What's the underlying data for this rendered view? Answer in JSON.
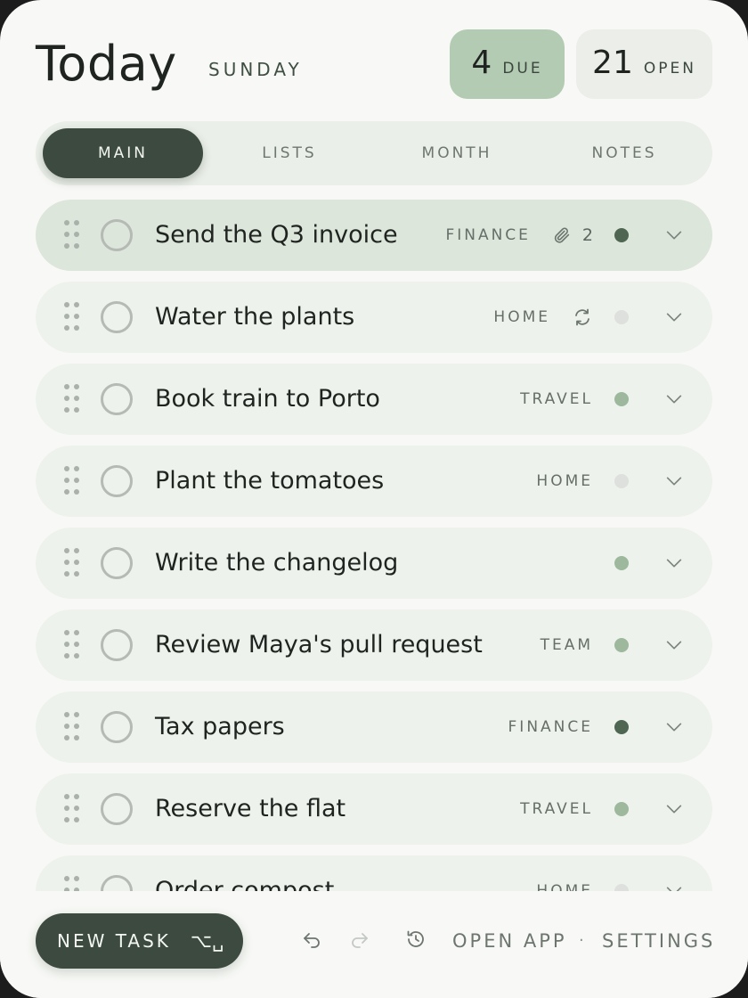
{
  "header": {
    "title": "Today",
    "weekday": "SUNDAY",
    "due": {
      "count": "4",
      "label": "DUE"
    },
    "open": {
      "count": "21",
      "label": "OPEN"
    }
  },
  "tabs": [
    {
      "label": "MAIN",
      "active": true
    },
    {
      "label": "LISTS",
      "active": false
    },
    {
      "label": "MONTH",
      "active": false
    },
    {
      "label": "NOTES",
      "active": false
    }
  ],
  "colors": {
    "accent_dark": "#3c4a3f",
    "accent_light": "#b4cbb3",
    "dot_dark": "#4f6652",
    "dot_medium": "#9db89c",
    "dot_light": "#dde0dc"
  },
  "tasks": [
    {
      "title": "Send the Q3 invoice",
      "tag": "FINANCE",
      "attachments": "2",
      "icon": "paperclip-icon",
      "priority": "dark",
      "highlighted": true
    },
    {
      "title": "Water the plants",
      "tag": "HOME",
      "icon": "repeat-icon",
      "priority": "light"
    },
    {
      "title": "Book train to Porto",
      "tag": "TRAVEL",
      "priority": "medium"
    },
    {
      "title": "Plant the tomatoes",
      "tag": "HOME",
      "priority": "light"
    },
    {
      "title": "Write the changelog",
      "tag": "",
      "priority": "medium"
    },
    {
      "title": "Review Maya's pull request",
      "tag": "TEAM",
      "priority": "medium"
    },
    {
      "title": "Tax papers",
      "tag": "FINANCE",
      "priority": "dark"
    },
    {
      "title": "Reserve the flat",
      "tag": "TRAVEL",
      "priority": "medium"
    },
    {
      "title": "Order compost",
      "tag": "HOME",
      "priority": "light"
    }
  ],
  "footer": {
    "new_task": "NEW TASK",
    "new_task_shortcut": "⌥␣",
    "undo_icon": "undo-icon",
    "redo_icon": "redo-icon",
    "history_icon": "history-icon",
    "open_app": "OPEN APP",
    "separator": "·",
    "settings": "SETTINGS"
  }
}
